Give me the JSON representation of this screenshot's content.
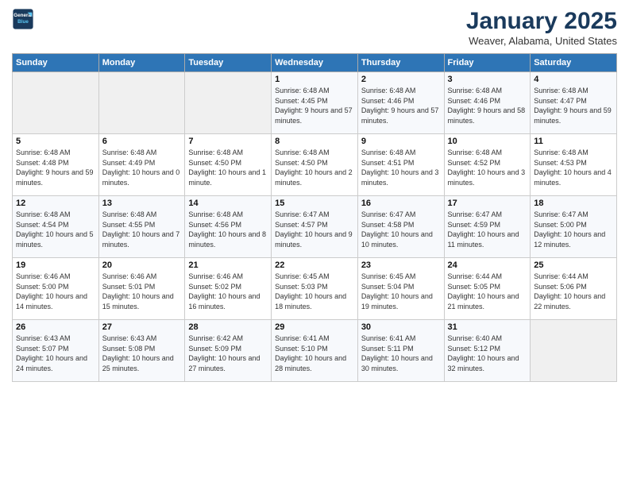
{
  "logo": {
    "line1": "General",
    "line2": "Blue"
  },
  "header": {
    "title": "January 2025",
    "location": "Weaver, Alabama, United States"
  },
  "weekdays": [
    "Sunday",
    "Monday",
    "Tuesday",
    "Wednesday",
    "Thursday",
    "Friday",
    "Saturday"
  ],
  "weeks": [
    [
      {
        "day": "",
        "empty": true
      },
      {
        "day": "",
        "empty": true
      },
      {
        "day": "",
        "empty": true
      },
      {
        "day": "1",
        "sunrise": "6:48 AM",
        "sunset": "4:45 PM",
        "daylight": "9 hours and 57 minutes."
      },
      {
        "day": "2",
        "sunrise": "6:48 AM",
        "sunset": "4:46 PM",
        "daylight": "9 hours and 57 minutes."
      },
      {
        "day": "3",
        "sunrise": "6:48 AM",
        "sunset": "4:46 PM",
        "daylight": "9 hours and 58 minutes."
      },
      {
        "day": "4",
        "sunrise": "6:48 AM",
        "sunset": "4:47 PM",
        "daylight": "9 hours and 59 minutes."
      }
    ],
    [
      {
        "day": "5",
        "sunrise": "6:48 AM",
        "sunset": "4:48 PM",
        "daylight": "9 hours and 59 minutes."
      },
      {
        "day": "6",
        "sunrise": "6:48 AM",
        "sunset": "4:49 PM",
        "daylight": "10 hours and 0 minutes."
      },
      {
        "day": "7",
        "sunrise": "6:48 AM",
        "sunset": "4:50 PM",
        "daylight": "10 hours and 1 minute."
      },
      {
        "day": "8",
        "sunrise": "6:48 AM",
        "sunset": "4:50 PM",
        "daylight": "10 hours and 2 minutes."
      },
      {
        "day": "9",
        "sunrise": "6:48 AM",
        "sunset": "4:51 PM",
        "daylight": "10 hours and 3 minutes."
      },
      {
        "day": "10",
        "sunrise": "6:48 AM",
        "sunset": "4:52 PM",
        "daylight": "10 hours and 3 minutes."
      },
      {
        "day": "11",
        "sunrise": "6:48 AM",
        "sunset": "4:53 PM",
        "daylight": "10 hours and 4 minutes."
      }
    ],
    [
      {
        "day": "12",
        "sunrise": "6:48 AM",
        "sunset": "4:54 PM",
        "daylight": "10 hours and 5 minutes."
      },
      {
        "day": "13",
        "sunrise": "6:48 AM",
        "sunset": "4:55 PM",
        "daylight": "10 hours and 7 minutes."
      },
      {
        "day": "14",
        "sunrise": "6:48 AM",
        "sunset": "4:56 PM",
        "daylight": "10 hours and 8 minutes."
      },
      {
        "day": "15",
        "sunrise": "6:47 AM",
        "sunset": "4:57 PM",
        "daylight": "10 hours and 9 minutes."
      },
      {
        "day": "16",
        "sunrise": "6:47 AM",
        "sunset": "4:58 PM",
        "daylight": "10 hours and 10 minutes."
      },
      {
        "day": "17",
        "sunrise": "6:47 AM",
        "sunset": "4:59 PM",
        "daylight": "10 hours and 11 minutes."
      },
      {
        "day": "18",
        "sunrise": "6:47 AM",
        "sunset": "5:00 PM",
        "daylight": "10 hours and 12 minutes."
      }
    ],
    [
      {
        "day": "19",
        "sunrise": "6:46 AM",
        "sunset": "5:00 PM",
        "daylight": "10 hours and 14 minutes."
      },
      {
        "day": "20",
        "sunrise": "6:46 AM",
        "sunset": "5:01 PM",
        "daylight": "10 hours and 15 minutes."
      },
      {
        "day": "21",
        "sunrise": "6:46 AM",
        "sunset": "5:02 PM",
        "daylight": "10 hours and 16 minutes."
      },
      {
        "day": "22",
        "sunrise": "6:45 AM",
        "sunset": "5:03 PM",
        "daylight": "10 hours and 18 minutes."
      },
      {
        "day": "23",
        "sunrise": "6:45 AM",
        "sunset": "5:04 PM",
        "daylight": "10 hours and 19 minutes."
      },
      {
        "day": "24",
        "sunrise": "6:44 AM",
        "sunset": "5:05 PM",
        "daylight": "10 hours and 21 minutes."
      },
      {
        "day": "25",
        "sunrise": "6:44 AM",
        "sunset": "5:06 PM",
        "daylight": "10 hours and 22 minutes."
      }
    ],
    [
      {
        "day": "26",
        "sunrise": "6:43 AM",
        "sunset": "5:07 PM",
        "daylight": "10 hours and 24 minutes."
      },
      {
        "day": "27",
        "sunrise": "6:43 AM",
        "sunset": "5:08 PM",
        "daylight": "10 hours and 25 minutes."
      },
      {
        "day": "28",
        "sunrise": "6:42 AM",
        "sunset": "5:09 PM",
        "daylight": "10 hours and 27 minutes."
      },
      {
        "day": "29",
        "sunrise": "6:41 AM",
        "sunset": "5:10 PM",
        "daylight": "10 hours and 28 minutes."
      },
      {
        "day": "30",
        "sunrise": "6:41 AM",
        "sunset": "5:11 PM",
        "daylight": "10 hours and 30 minutes."
      },
      {
        "day": "31",
        "sunrise": "6:40 AM",
        "sunset": "5:12 PM",
        "daylight": "10 hours and 32 minutes."
      },
      {
        "day": "",
        "empty": true
      }
    ]
  ]
}
